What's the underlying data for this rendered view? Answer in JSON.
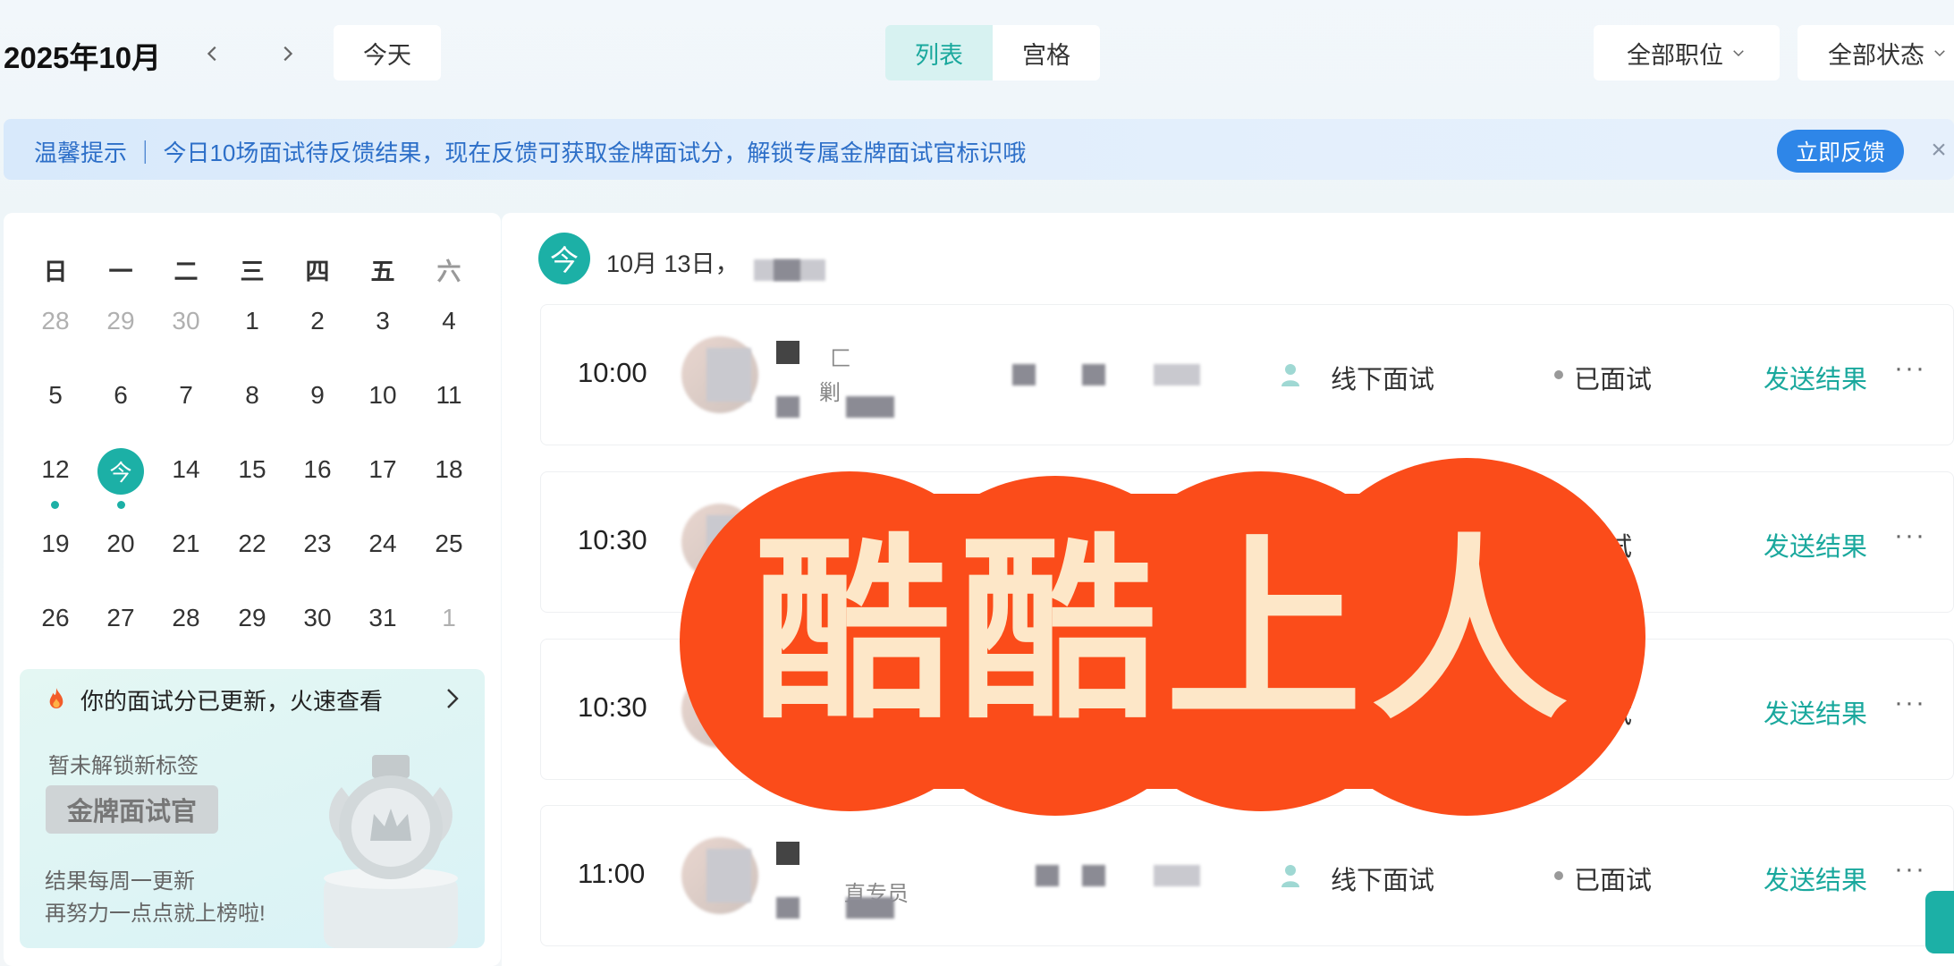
{
  "header": {
    "month_title": "2025年10月",
    "today_button": "今天",
    "view_list": "列表",
    "view_grid": "宫格",
    "filter_position": "全部职位",
    "filter_status": "全部状态"
  },
  "notice": {
    "text": "温馨提示 ｜ 今日10场面试待反馈结果，现在反馈可获取金牌面试分，解锁专属金牌面试官标识哦",
    "button": "立即反馈",
    "close": "×"
  },
  "calendar": {
    "weekdays": [
      "日",
      "一",
      "二",
      "三",
      "四",
      "五",
      "六"
    ],
    "today_label": "今",
    "weeks": [
      [
        "28",
        "29",
        "30",
        "1",
        "2",
        "3",
        "4"
      ],
      [
        "5",
        "6",
        "7",
        "8",
        "9",
        "10",
        "11"
      ],
      [
        "12",
        "今",
        "14",
        "15",
        "16",
        "17",
        "18"
      ],
      [
        "19",
        "20",
        "21",
        "22",
        "23",
        "24",
        "25"
      ],
      [
        "26",
        "27",
        "28",
        "29",
        "30",
        "31",
        "1"
      ]
    ]
  },
  "promo": {
    "title": "你的面试分已更新，火速查看",
    "subtitle": "暂未解锁新标签",
    "badge": "金牌面试官",
    "footer1": "结果每周一更新",
    "footer2": "再努力一点点就上榜啦!"
  },
  "schedule": {
    "today_icon": "今",
    "date_label": "10月 13日，",
    "send_label": "发送结果",
    "more_label": "···",
    "rows": [
      {
        "time": "10:00",
        "mode": "线下面试",
        "status": "已面试",
        "name_hint": "匚",
        "role_hint": "剿"
      },
      {
        "time": "10:30",
        "mode": "",
        "status": "试",
        "name_hint": "",
        "role_hint": ""
      },
      {
        "time": "10:30",
        "mode": "",
        "status": "试",
        "name_hint": "",
        "role_hint": ""
      },
      {
        "time": "11:00",
        "mode": "线下面试",
        "status": "已面试",
        "name_hint": "",
        "role_hint": "直专员"
      }
    ]
  },
  "watermark": {
    "text": "酷酷上人",
    "color": "#fb4c1a"
  },
  "colors": {
    "accent": "#1cb0a6",
    "notice_blue": "#2e86e8"
  }
}
